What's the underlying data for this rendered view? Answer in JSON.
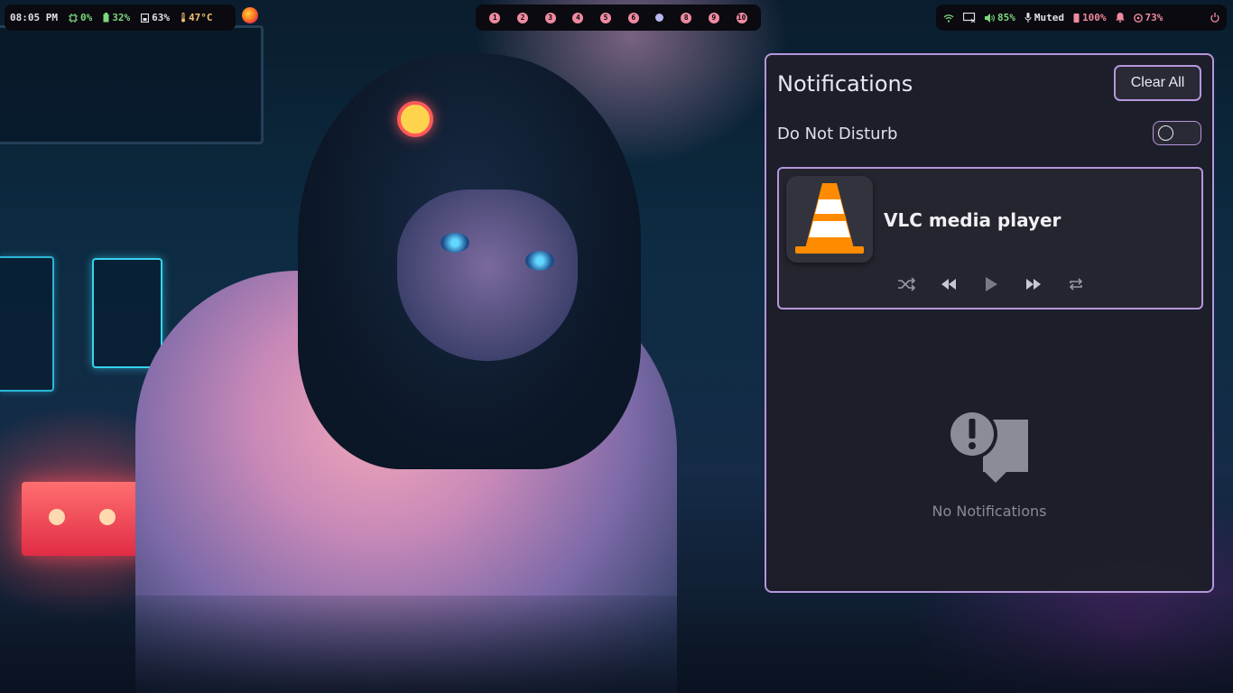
{
  "top_bar": {
    "left": {
      "time": "08:05 PM",
      "cpu": "0%",
      "battery": "32%",
      "memory": "63%",
      "temperature": "47°C"
    },
    "workspaces": [
      "1",
      "2",
      "3",
      "4",
      "5",
      "6",
      "",
      "8",
      "9",
      "10"
    ],
    "active_workspace_index": 6,
    "right": {
      "volume": "85%",
      "microphone": "Muted",
      "brightness": "100%",
      "disk": "73%"
    },
    "colors": {
      "bar_bg": "#0a0a10",
      "time": "#e0e0ea",
      "cpu": "#7dd87d",
      "battery": "#7dd87d",
      "memory": "#e0e0ea",
      "temperature": "#f0c070",
      "workspace": "#f08aa0",
      "wifi": "#7dd87d",
      "volume": "#7dd87d",
      "microphone": "#e0e0ea",
      "brightness": "#f08aa0",
      "disk": "#f08aa0",
      "power": "#f08aa0"
    }
  },
  "notifications": {
    "title": "Notifications",
    "clear_all_label": "Clear All",
    "dnd_label": "Do Not Disturb",
    "dnd_enabled": false,
    "media": {
      "app_name": "VLC media player",
      "icon": "vlc-cone-icon",
      "controls": [
        "shuffle-icon",
        "previous-icon",
        "play-icon",
        "next-icon",
        "repeat-icon"
      ]
    },
    "empty_text": "No Notifications",
    "accent": "#b596dc"
  }
}
